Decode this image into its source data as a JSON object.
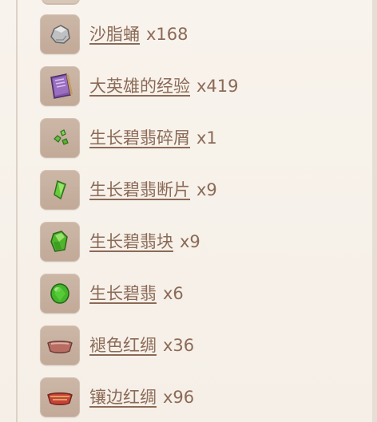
{
  "items": [
    {
      "icon": "stone-icon",
      "name": "沙脂蛹",
      "count": "x168"
    },
    {
      "icon": "book-icon",
      "name": "大英雄的经验",
      "count": "x419"
    },
    {
      "icon": "jade-sliver-icon",
      "name": "生长碧翡碎屑",
      "count": "x1"
    },
    {
      "icon": "jade-fragment-icon",
      "name": "生长碧翡断片",
      "count": "x9"
    },
    {
      "icon": "jade-chunk-icon",
      "name": "生长碧翡块",
      "count": "x9"
    },
    {
      "icon": "jade-gemstone-icon",
      "name": "生长碧翡",
      "count": "x6"
    },
    {
      "icon": "faded-silk-icon",
      "name": "褪色红绸",
      "count": "x36"
    },
    {
      "icon": "trimmed-silk-icon",
      "name": "镶边红绸",
      "count": "x96"
    }
  ]
}
